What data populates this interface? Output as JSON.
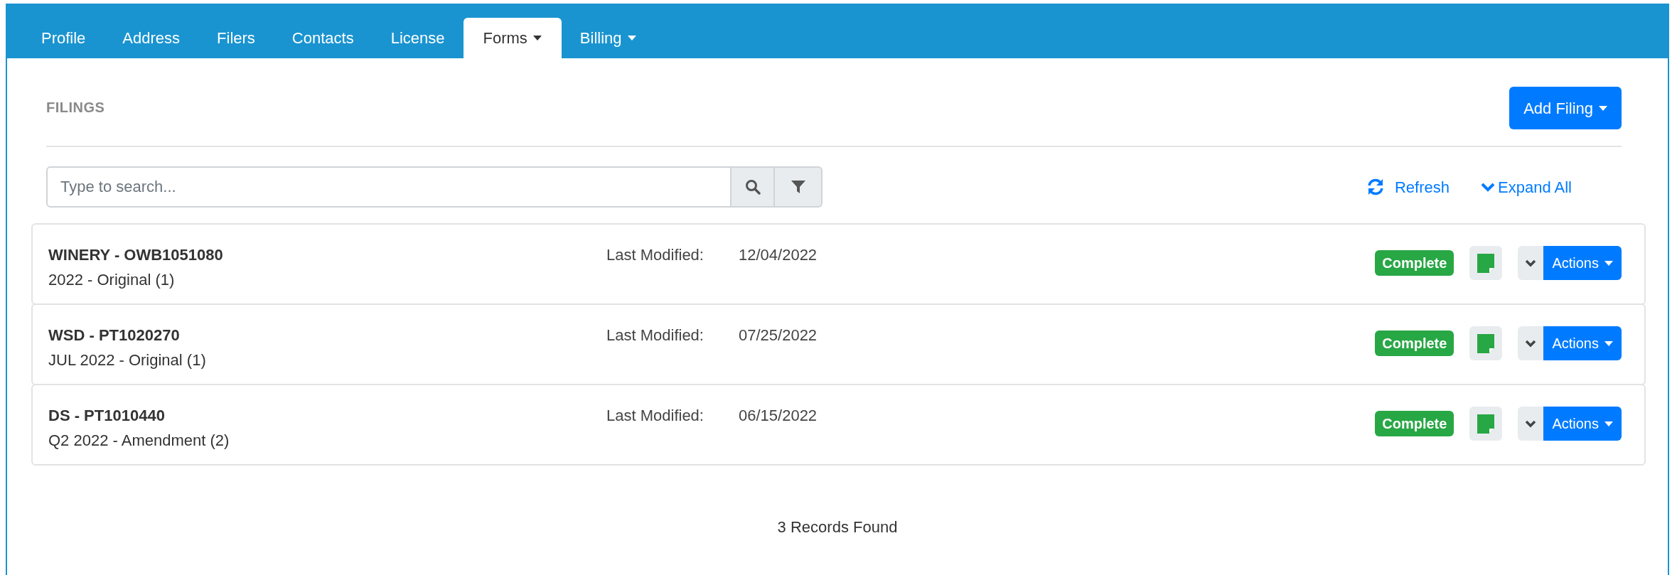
{
  "tabs": [
    {
      "label": "Profile",
      "selected": false,
      "dropdown": false
    },
    {
      "label": "Address",
      "selected": false,
      "dropdown": false
    },
    {
      "label": "Filers",
      "selected": false,
      "dropdown": false
    },
    {
      "label": "Contacts",
      "selected": false,
      "dropdown": false
    },
    {
      "label": "License",
      "selected": false,
      "dropdown": false
    },
    {
      "label": "Forms",
      "selected": true,
      "dropdown": true
    },
    {
      "label": "Billing",
      "selected": false,
      "dropdown": true
    }
  ],
  "section_title": "FILINGS",
  "add_button": "Add Filing",
  "search": {
    "placeholder": "Type to search..."
  },
  "refresh": "Refresh",
  "expand_all": "Expand All",
  "filings": [
    {
      "title": "WINERY - OWB1051080",
      "subtitle": "2022 - Original (1)",
      "modified_label": "Last Modified:",
      "modified": "12/04/2022",
      "status": "Complete",
      "actions": "Actions"
    },
    {
      "title": "WSD - PT1020270",
      "subtitle": "JUL 2022 - Original (1)",
      "modified_label": "Last Modified:",
      "modified": "07/25/2022",
      "status": "Complete",
      "actions": "Actions"
    },
    {
      "title": "DS - PT1010440",
      "subtitle": "Q2 2022 - Amendment (2)",
      "modified_label": "Last Modified:",
      "modified": "06/15/2022",
      "status": "Complete",
      "actions": "Actions"
    }
  ],
  "records": "3 Records Found"
}
